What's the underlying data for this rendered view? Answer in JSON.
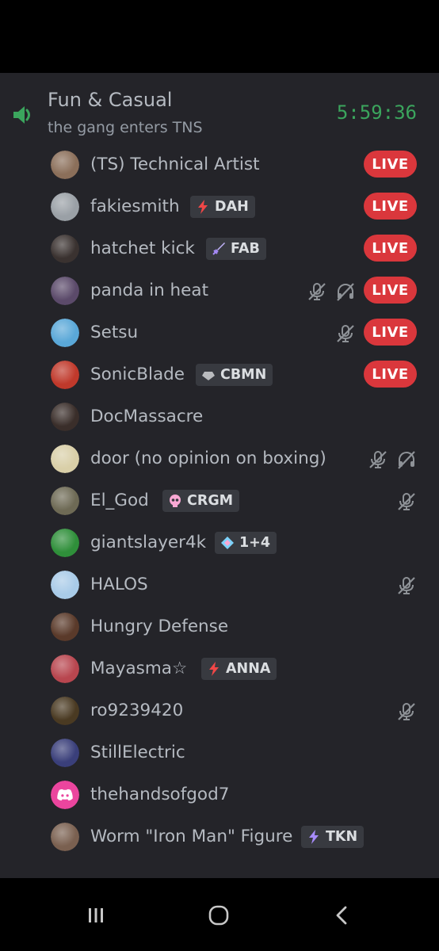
{
  "channel": {
    "name": "Fun & Casual",
    "status": "the gang enters TNS",
    "timer": "5:59:36",
    "icon": "speaker-icon"
  },
  "live_label": "LIVE",
  "users": [
    {
      "name": "(TS) Technical Artist",
      "live": true,
      "avatar_color": "#8b6f5a"
    },
    {
      "name": "fakiesmith",
      "tag": "DAH",
      "tag_icon": "lightning",
      "live": true,
      "avatar_color": "#9aa0a6"
    },
    {
      "name": "hatchet kick",
      "tag": "FAB",
      "tag_icon": "sword",
      "live": true,
      "avatar_color": "#3a3230"
    },
    {
      "name": "panda in heat",
      "live": true,
      "muted": true,
      "deafened": true,
      "avatar_color": "#5b4a6a"
    },
    {
      "name": "Setsu",
      "live": true,
      "muted": true,
      "avatar_color": "#5aa8d8"
    },
    {
      "name": "SonicBlade",
      "tag": "CBMN",
      "tag_icon": "gem",
      "live": true,
      "avatar_color": "#c0392b"
    },
    {
      "name": "DocMassacre",
      "avatar_color": "#3a2e2a"
    },
    {
      "name": "door (no opinion on boxing)",
      "muted": true,
      "deafened": true,
      "avatar_color": "#d9cfa8"
    },
    {
      "name": "El_God",
      "tag": "CRGM",
      "tag_icon": "skull",
      "muted": true,
      "avatar_color": "#6e6a55"
    },
    {
      "name": "giantslayer4k",
      "tag": "1+4",
      "tag_icon": "diamond",
      "avatar_color": "#2f8f3a"
    },
    {
      "name": "HALOS",
      "muted": true,
      "avatar_color": "#a9cbe8"
    },
    {
      "name": "Hungry Defense",
      "avatar_color": "#5a3a2a"
    },
    {
      "name": "Mayasma☆",
      "tag": "ANNA",
      "tag_icon": "lightning",
      "avatar_color": "#b8464f"
    },
    {
      "name": "ro9239420",
      "muted": true,
      "avatar_color": "#4a3a22"
    },
    {
      "name": "StillElectric",
      "avatar_color": "#3a3f7a"
    },
    {
      "name": "thehandsofgod7",
      "avatar_color": "#eb459e",
      "avatar_icon": "discord-logo"
    },
    {
      "name": "Worm \"Iron Man\" Figure",
      "tag": "TKN",
      "tag_icon": "lightning-purple",
      "avatar_color": "#7a6050"
    }
  ],
  "nav": {
    "recents": "recents-icon",
    "home": "home-icon",
    "back": "back-icon"
  }
}
